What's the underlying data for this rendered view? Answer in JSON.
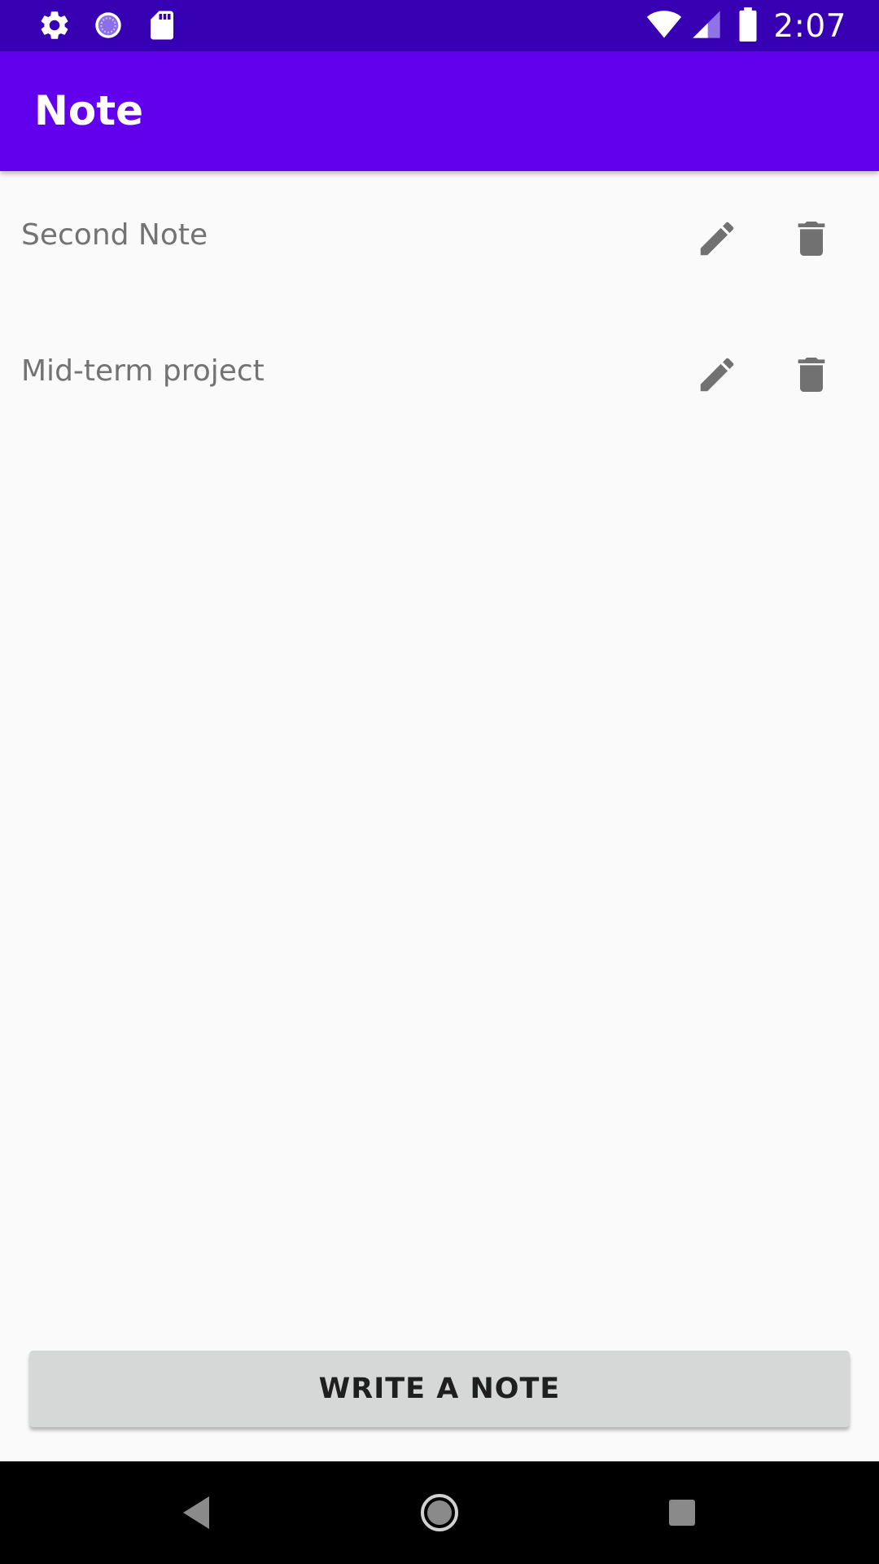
{
  "status_bar": {
    "time": "2:07",
    "left_icons": [
      "settings-icon",
      "sync-circle-icon",
      "sd-card-icon"
    ],
    "right_icons": [
      "wifi-icon",
      "cell-signal-icon",
      "battery-icon"
    ],
    "background": "#3700B3"
  },
  "app_bar": {
    "title": "Note",
    "background": "#6200EE"
  },
  "notes": [
    {
      "title": "Second Note",
      "edit_icon": "pencil-icon",
      "delete_icon": "trash-icon"
    },
    {
      "title": "Mid-term project",
      "edit_icon": "pencil-icon",
      "delete_icon": "trash-icon"
    }
  ],
  "actions": {
    "write_label": "WRITE A NOTE"
  },
  "nav_bar": {
    "icons": [
      "back-icon",
      "home-icon",
      "recents-icon"
    ]
  }
}
